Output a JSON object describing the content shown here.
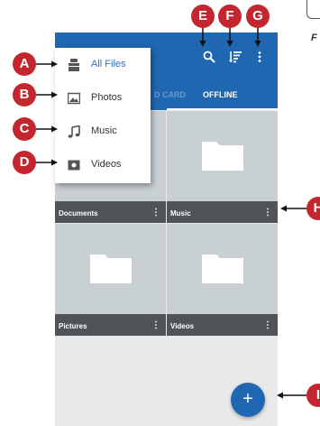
{
  "drawer": {
    "items": [
      {
        "label": "All Files",
        "icon": "all-files-icon",
        "active": true
      },
      {
        "label": "Photos",
        "icon": "photos-icon"
      },
      {
        "label": "Music",
        "icon": "music-note-icon"
      },
      {
        "label": "Videos",
        "icon": "videos-icon"
      }
    ]
  },
  "tabs": {
    "partial_label": "D CARD",
    "offline_label": "OFFLINE"
  },
  "folders": [
    {
      "label": "Documents"
    },
    {
      "label": "Music"
    },
    {
      "label": "Pictures"
    },
    {
      "label": "Videos"
    }
  ],
  "toolbar": {
    "search_icon": "search-icon",
    "sort_icon": "sort-icon",
    "more_icon": "more-vert-icon",
    "folder_more": "⋮"
  },
  "fab": {
    "label": "+"
  },
  "callouts": {
    "a": "A",
    "b": "B",
    "c": "C",
    "d": "D",
    "e": "E",
    "f": "F",
    "g": "G",
    "h": "H",
    "i": "I"
  },
  "fragment": {
    "letter": "F"
  },
  "colors": {
    "app_blue": "#1f67b1",
    "callout_red": "#c3262e",
    "tile_gray": "#c9d0d3",
    "label_bar": "#4f5458",
    "active_item": "#2f6fc0"
  }
}
